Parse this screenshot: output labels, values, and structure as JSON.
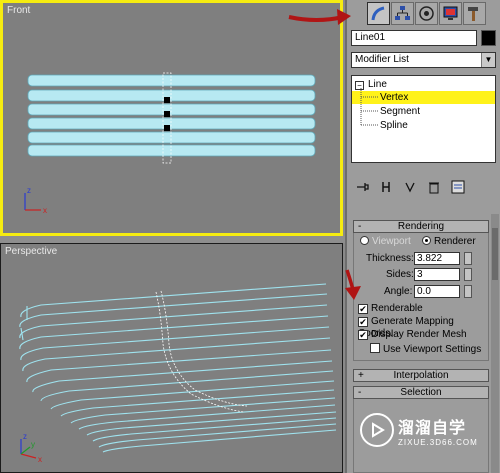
{
  "viewports": {
    "front_label": "Front",
    "perspective_label": "Perspective",
    "axis_z": "z",
    "axis_x": "x",
    "axis_y": "y"
  },
  "panel": {
    "object_name": "Line01",
    "object_color": "#000000",
    "modifier_list": "Modifier List",
    "stack": {
      "line": "Line",
      "vertex": "Vertex",
      "segment": "Segment",
      "spline": "Spline"
    },
    "rendering": {
      "title": "Rendering",
      "collapse": "-",
      "viewport_option": "Viewport",
      "renderer_option": "Renderer",
      "thickness_label": "Thickness:",
      "thickness_value": "3.822",
      "sides_label": "Sides:",
      "sides_value": "3",
      "angle_label": "Angle:",
      "angle_value": "0.0",
      "renderable": "Renderable",
      "gen_mapping": "Generate Mapping Coords.",
      "display_mesh": "Display Render Mesh",
      "use_viewport": "Use Viewport Settings"
    },
    "interpolation": {
      "title": "Interpolation",
      "expand": "+"
    },
    "selection": {
      "title": "Selection",
      "collapse": "-"
    }
  },
  "watermark": {
    "chinese": "溜溜自学",
    "pinyin": "ZIXUE.3D66.COM"
  },
  "colors": {
    "active_viewport_border": "#f6ec10",
    "wire_color": "#9fe3ef",
    "annotation_arrow": "#b01515",
    "stack_selected": "#fff21a"
  }
}
